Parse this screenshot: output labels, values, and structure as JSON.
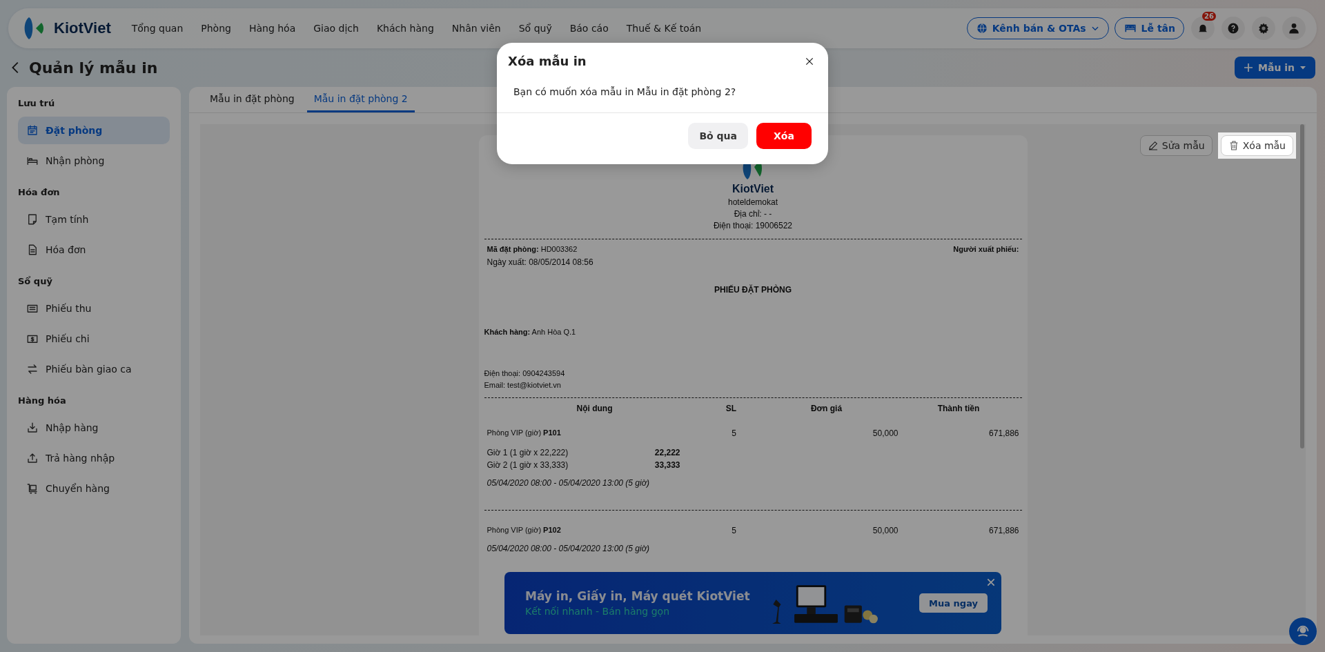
{
  "nav": {
    "brand": "KiotViet",
    "items": [
      {
        "label": "Tổng quan",
        "selected": false
      },
      {
        "label": "Phòng",
        "selected": false
      },
      {
        "label": "Hàng hóa",
        "selected": false
      },
      {
        "label": "Giao dịch",
        "selected": false
      },
      {
        "label": "Khách hàng",
        "selected": false
      },
      {
        "label": "Nhân viên",
        "selected": false
      },
      {
        "label": "Sổ quỹ",
        "selected": false
      },
      {
        "label": "Báo cáo",
        "selected": false
      },
      {
        "label": "Thuế & Kế toán",
        "selected": false
      }
    ],
    "channel_button": "Kênh bán & OTAs",
    "reception_button": "Lễ tân",
    "notification_count": "26"
  },
  "page": {
    "title": "Quản lý mẫu in",
    "add_button": "Mẫu in"
  },
  "sidebar": {
    "groups": [
      {
        "title": "Lưu trú",
        "items": [
          {
            "label": "Đặt phòng",
            "selected": true
          },
          {
            "label": "Nhận phòng",
            "selected": false
          }
        ]
      },
      {
        "title": "Hóa đơn",
        "items": [
          {
            "label": "Tạm tính",
            "selected": false
          },
          {
            "label": "Hóa đơn",
            "selected": false
          }
        ]
      },
      {
        "title": "Sổ quỹ",
        "items": [
          {
            "label": "Phiếu thu",
            "selected": false
          },
          {
            "label": "Phiếu chi",
            "selected": false
          },
          {
            "label": "Phiếu bàn giao ca",
            "selected": false
          }
        ]
      },
      {
        "title": "Hàng hóa",
        "items": [
          {
            "label": "Nhập hàng",
            "selected": false
          },
          {
            "label": "Trả hàng nhập",
            "selected": false
          },
          {
            "label": "Chuyển hàng",
            "selected": false
          }
        ]
      }
    ]
  },
  "tabs": [
    {
      "label": "Mẫu in đặt phòng",
      "selected": false
    },
    {
      "label": "Mẫu in đặt phòng 2",
      "selected": true
    }
  ],
  "actions": {
    "edit": "Sửa mẫu",
    "delete": "Xóa mẫu"
  },
  "document": {
    "brand": "KiotViet",
    "shop": "hoteldemokat",
    "address": "Địa chỉ: - -",
    "phone": "Điện thoại: 19006522",
    "booking_code": "**Mã đặt phòng:** HD003362",
    "issuer": "Người xuất phiếu:",
    "export_date": "Ngày xuất: 08/05/2014 08:56",
    "heading": "PHIẾU ĐẶT PHÒNG",
    "customer": "**Khách hàng:** Anh Hòa Q.1",
    "customer_phone": "Điện thoại: 0904243594",
    "customer_email": "Email: test@kiotviet.vn",
    "columns": [
      "Nội dung",
      "SL",
      "Đơn giá",
      "Thành tiền"
    ],
    "items": [
      {
        "name": "Phòng VIP (giờ) **P101**",
        "qty": "5",
        "price": "50,000",
        "total": "671,886",
        "hours": [
          {
            "label": "Giờ 1 (1 giờ x 22,222)",
            "amount": "22,222"
          },
          {
            "label": "Giờ 2 (1 giờ x 33,333)",
            "amount": "33,333"
          }
        ],
        "period": "05/04/2020 08:00 - 05/04/2020 13:00 (5 giờ)"
      },
      {
        "name": "Phòng VIP (giờ) **P102**",
        "qty": "5",
        "price": "50,000",
        "total": "671,886",
        "period": "05/04/2020 08:00 - 05/04/2020 13:00 (5 giờ)"
      }
    ]
  },
  "banner": {
    "title": "Máy in, Giấy in, Máy quét KiotViet",
    "subtitle": "Kết nối nhanh - Bán hàng gọn",
    "button": "Mua ngay"
  },
  "dialog": {
    "title": "Xóa mẫu in",
    "message": "Bạn có muốn xóa mẫu in Mẫu in đặt phòng 2?",
    "cancel": "Bỏ qua",
    "confirm": "Xóa"
  }
}
